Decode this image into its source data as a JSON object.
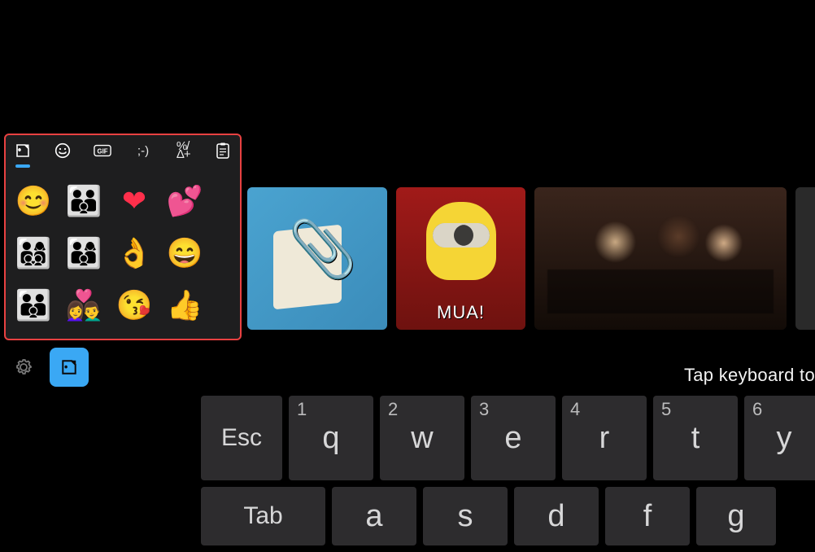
{
  "emoji_panel": {
    "tabs": [
      {
        "id": "sticker",
        "active": true
      },
      {
        "id": "emoji",
        "active": false
      },
      {
        "id": "gif",
        "active": false
      },
      {
        "id": "kaomoji",
        "active": false
      },
      {
        "id": "symbols",
        "active": false
      },
      {
        "id": "clipboard",
        "active": false
      }
    ],
    "emojis": [
      "😊",
      "👨‍👨‍👦",
      "❤",
      "💕",
      "👨‍👩‍👦‍👦",
      "👨‍👩‍👦",
      "👌",
      "😄",
      "👨‍👨‍👦",
      "👩‍❤️‍👨",
      "😘",
      "👍"
    ]
  },
  "gif_row": [
    {
      "id": "clippy",
      "caption": ""
    },
    {
      "id": "minion",
      "caption": "MUA!"
    },
    {
      "id": "oscars",
      "caption": ""
    },
    {
      "id": "partial",
      "caption": ""
    }
  ],
  "toolbar": {
    "settings": "settings",
    "emoji_keyboard": "emoji-keyboard"
  },
  "hint": "Tap keyboard to",
  "keyboard": {
    "row1": [
      {
        "label": "Esc",
        "num": ""
      },
      {
        "label": "q",
        "num": "1"
      },
      {
        "label": "w",
        "num": "2"
      },
      {
        "label": "e",
        "num": "3"
      },
      {
        "label": "r",
        "num": "4"
      },
      {
        "label": "t",
        "num": "5"
      },
      {
        "label": "y",
        "num": "6"
      }
    ],
    "row2": [
      {
        "label": "Tab",
        "num": ""
      },
      {
        "label": "a",
        "num": ""
      },
      {
        "label": "s",
        "num": ""
      },
      {
        "label": "d",
        "num": ""
      },
      {
        "label": "f",
        "num": ""
      },
      {
        "label": "g",
        "num": ""
      }
    ]
  }
}
